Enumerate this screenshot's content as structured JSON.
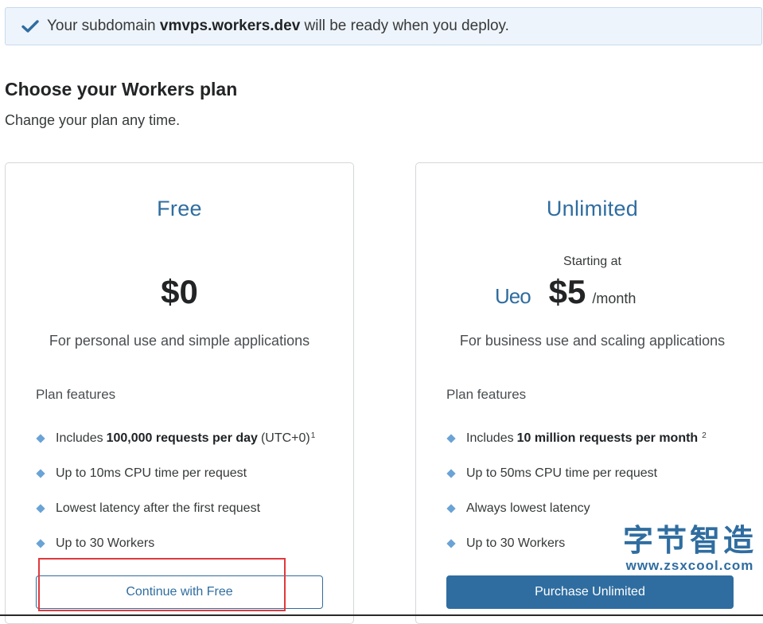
{
  "banner": {
    "icon": "check-icon",
    "text_before": "Your subdomain ",
    "subdomain": "vmvps.workers.dev",
    "text_after": " will be ready when you deploy."
  },
  "page": {
    "title": "Choose your Workers plan",
    "subtitle": "Change your plan any time."
  },
  "plans": {
    "free": {
      "name": "Free",
      "price": "$0",
      "description": "For personal use and simple applications",
      "features_label": "Plan features",
      "features": [
        {
          "pre": "Includes",
          "bold": "100,000 requests per day",
          "post": "(UTC+0)",
          "sup": "1"
        },
        {
          "text": "Up to 10ms CPU time per request"
        },
        {
          "text": "Lowest latency after the first request"
        },
        {
          "text": "Up to 30 Workers"
        }
      ],
      "button_label": "Continue with Free"
    },
    "unlimited": {
      "name": "Unlimited",
      "starting_at": "Starting at",
      "price": "$5",
      "per": "/month",
      "description": "For business use and scaling applications",
      "features_label": "Plan features",
      "features": [
        {
          "pre": "Includes",
          "bold": "10 million requests per month",
          "post": "",
          "sup": "2"
        },
        {
          "text": "Up to 50ms CPU time per request"
        },
        {
          "text": "Always lowest latency"
        },
        {
          "text": "Up to 30 Workers"
        }
      ],
      "button_label": "Purchase Unlimited"
    }
  },
  "watermark": {
    "ghost_text": "Ueo",
    "chinese": "字节智造",
    "url": "www.zsxcool.com"
  },
  "colors": {
    "accent": "#2f6da0",
    "banner_bg": "#eef4fb",
    "annotation": "#e0393d"
  }
}
